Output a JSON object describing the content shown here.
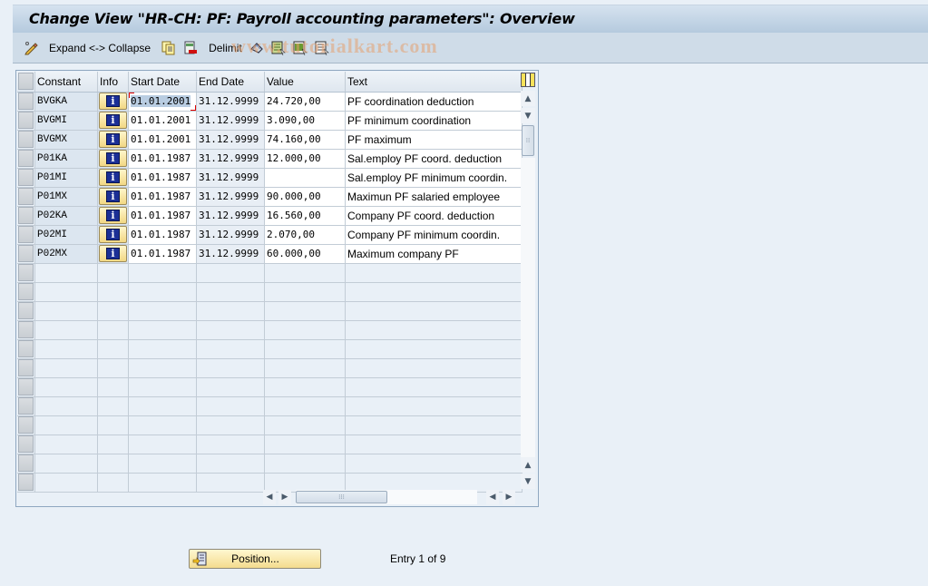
{
  "window": {
    "title": "Change View \"HR-CH: PF: Payroll accounting parameters\": Overview"
  },
  "toolbar": {
    "items": [
      {
        "icon": "edit-pencil-icon",
        "label": ""
      },
      {
        "icon": "",
        "label": "Expand <-> Collapse"
      },
      {
        "icon": "copy-icon",
        "label": ""
      },
      {
        "icon": "delete-row-icon",
        "label": ""
      },
      {
        "icon": "",
        "label": "Delimit"
      },
      {
        "icon": "undo-change-icon",
        "label": ""
      },
      {
        "icon": "select-all-icon",
        "label": ""
      },
      {
        "icon": "select-block-icon",
        "label": ""
      },
      {
        "icon": "deselect-all-icon",
        "label": ""
      }
    ],
    "watermark": "www.tutorialkart.com"
  },
  "table": {
    "columns": [
      "Constant",
      "Info",
      "Start Date",
      "End Date",
      "Value",
      "Text"
    ],
    "rows": [
      {
        "constant": "BVGKA",
        "start": "01.01.2001",
        "end": "31.12.9999",
        "value": "24.720,00",
        "text": "PF coordination deduction"
      },
      {
        "constant": "BVGMI",
        "start": "01.01.2001",
        "end": "31.12.9999",
        "value": "3.090,00",
        "text": "PF minimum coordination"
      },
      {
        "constant": "BVGMX",
        "start": "01.01.2001",
        "end": "31.12.9999",
        "value": "74.160,00",
        "text": "PF maximum"
      },
      {
        "constant": "P01KA",
        "start": "01.01.1987",
        "end": "31.12.9999",
        "value": "12.000,00",
        "text": "Sal.employ PF coord. deduction"
      },
      {
        "constant": "P01MI",
        "start": "01.01.1987",
        "end": "31.12.9999",
        "value": "",
        "text": "Sal.employ PF minimum coordin."
      },
      {
        "constant": "P01MX",
        "start": "01.01.1987",
        "end": "31.12.9999",
        "value": "90.000,00",
        "text": "Maximun PF salaried employee"
      },
      {
        "constant": "P02KA",
        "start": "01.01.1987",
        "end": "31.12.9999",
        "value": "16.560,00",
        "text": "Company PF coord. deduction"
      },
      {
        "constant": "P02MI",
        "start": "01.01.1987",
        "end": "31.12.9999",
        "value": "2.070,00",
        "text": "Company PF minimum coordin."
      },
      {
        "constant": "P02MX",
        "start": "01.01.1987",
        "end": "31.12.9999",
        "value": "60.000,00",
        "text": "Maximum company PF"
      }
    ],
    "info_icon": "info-icon",
    "empty_rows": 12
  },
  "footer": {
    "position_button": "Position...",
    "entry_status": "Entry 1 of 9"
  }
}
